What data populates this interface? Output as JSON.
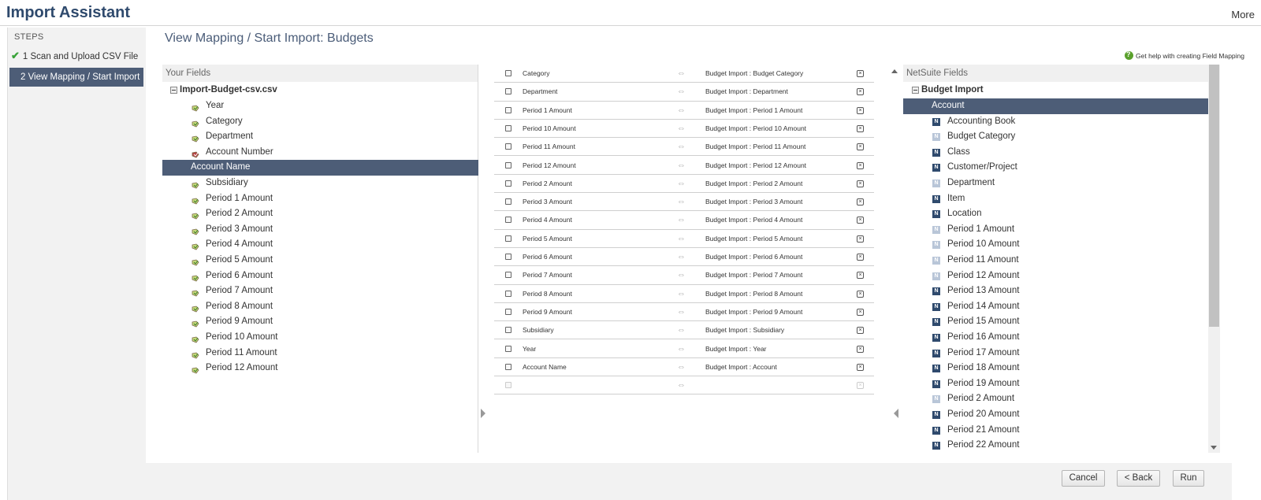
{
  "app": {
    "title": "Import Assistant",
    "more_label": "More"
  },
  "steps": {
    "title": "STEPS",
    "items": [
      {
        "label": "1 Scan and Upload CSV File",
        "done": true
      },
      {
        "label": "2 View Mapping / Start Import",
        "active": true
      }
    ]
  },
  "main": {
    "heading": "View Mapping / Start Import: Budgets",
    "help_link": "Get help with creating Field Mapping"
  },
  "your_fields": {
    "header": "Your Fields",
    "file_name": "Import-Budget-csv.csv",
    "selected": "Account Name",
    "items": [
      "Year",
      "Category",
      "Department",
      "Account Number",
      "Account Name",
      "Subsidiary",
      "Period 1 Amount",
      "Period 2 Amount",
      "Period 3 Amount",
      "Period 4 Amount",
      "Period 5 Amount",
      "Period 6 Amount",
      "Period 7 Amount",
      "Period 8 Amount",
      "Period 9 Amount",
      "Period 10 Amount",
      "Period 11 Amount",
      "Period 12 Amount"
    ]
  },
  "mappings": [
    {
      "source": "Category",
      "target": "Budget Import : Budget Category"
    },
    {
      "source": "Department",
      "target": "Budget Import : Department"
    },
    {
      "source": "Period 1 Amount",
      "target": "Budget Import : Period 1 Amount"
    },
    {
      "source": "Period 10 Amount",
      "target": "Budget Import : Period 10 Amount"
    },
    {
      "source": "Period 11 Amount",
      "target": "Budget Import : Period 11 Amount"
    },
    {
      "source": "Period 12 Amount",
      "target": "Budget Import : Period 12 Amount"
    },
    {
      "source": "Period 2 Amount",
      "target": "Budget Import : Period 2 Amount"
    },
    {
      "source": "Period 3 Amount",
      "target": "Budget Import : Period 3 Amount"
    },
    {
      "source": "Period 4 Amount",
      "target": "Budget Import : Period 4 Amount"
    },
    {
      "source": "Period 5 Amount",
      "target": "Budget Import : Period 5 Amount"
    },
    {
      "source": "Period 6 Amount",
      "target": "Budget Import : Period 6 Amount"
    },
    {
      "source": "Period 7 Amount",
      "target": "Budget Import : Period 7 Amount"
    },
    {
      "source": "Period 8 Amount",
      "target": "Budget Import : Period 8 Amount"
    },
    {
      "source": "Period 9 Amount",
      "target": "Budget Import : Period 9 Amount"
    },
    {
      "source": "Subsidiary",
      "target": "Budget Import : Subsidiary"
    },
    {
      "source": "Year",
      "target": "Budget Import : Year"
    },
    {
      "source": "Account Name",
      "target": "Budget Import : Account"
    },
    {
      "source": "",
      "target": ""
    }
  ],
  "netsuite_fields": {
    "header": "NetSuite Fields",
    "root": "Budget Import",
    "selected": "Account",
    "items": [
      {
        "label": "Account",
        "light": false
      },
      {
        "label": "Accounting Book",
        "light": false
      },
      {
        "label": "Budget Category",
        "light": true
      },
      {
        "label": "Class",
        "light": false
      },
      {
        "label": "Customer/Project",
        "light": false
      },
      {
        "label": "Department",
        "light": true
      },
      {
        "label": "Item",
        "light": false
      },
      {
        "label": "Location",
        "light": false
      },
      {
        "label": "Period 1 Amount",
        "light": true
      },
      {
        "label": "Period 10 Amount",
        "light": true
      },
      {
        "label": "Period 11 Amount",
        "light": true
      },
      {
        "label": "Period 12 Amount",
        "light": true
      },
      {
        "label": "Period 13 Amount",
        "light": false
      },
      {
        "label": "Period 14 Amount",
        "light": false
      },
      {
        "label": "Period 15 Amount",
        "light": false
      },
      {
        "label": "Period 16 Amount",
        "light": false
      },
      {
        "label": "Period 17 Amount",
        "light": false
      },
      {
        "label": "Period 18 Amount",
        "light": false
      },
      {
        "label": "Period 19 Amount",
        "light": false
      },
      {
        "label": "Period 2 Amount",
        "light": true
      },
      {
        "label": "Period 20 Amount",
        "light": false
      },
      {
        "label": "Period 21 Amount",
        "light": false
      },
      {
        "label": "Period 22 Amount",
        "light": false
      }
    ]
  },
  "buttons": {
    "cancel": "Cancel",
    "back": "< Back",
    "run": "Run"
  },
  "colors": {
    "title": "#2f4a6d",
    "selected_bg": "#4d5d77",
    "check": "#39a339"
  }
}
